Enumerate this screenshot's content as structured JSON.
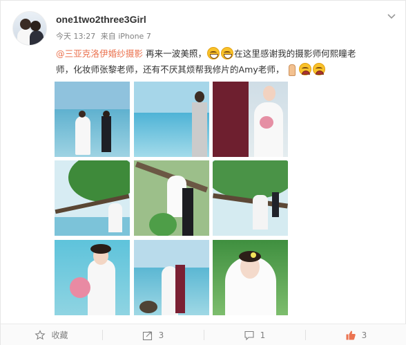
{
  "post": {
    "username": "one1two2three3Girl",
    "time": "今天 13:27",
    "source": "来自 iPhone 7",
    "mention": "@三亚克洛伊婚纱摄影",
    "text_part1": " 再来一波美照，",
    "text_part2": "在这里感谢我的摄影师何熙瞳老",
    "text_line2": "师，化妆师张黎老师，还有不厌其烦帮我修片的Amy老师，",
    "icons": {
      "more": "chevron-down-icon",
      "emoji_grin": "grinning-face-emoji",
      "emoji_pray": "praying-hands-emoji",
      "emoji_sad": "tearful-face-emoji"
    }
  },
  "photos": [
    "wedding-photo-beach-couple",
    "wedding-photo-groom-seaside",
    "wedding-photo-bride-bouquet",
    "wedding-photo-tree-couple",
    "wedding-photo-tree-kiss",
    "wedding-photo-tree-climb",
    "wedding-photo-bride-flowers",
    "wedding-photo-seaside-embrace",
    "wedding-photo-bride-portrait"
  ],
  "actions": {
    "favorite_label": "收藏",
    "share_count": "3",
    "comment_count": "1",
    "like_count": "3",
    "like_color": "#eb7350"
  }
}
